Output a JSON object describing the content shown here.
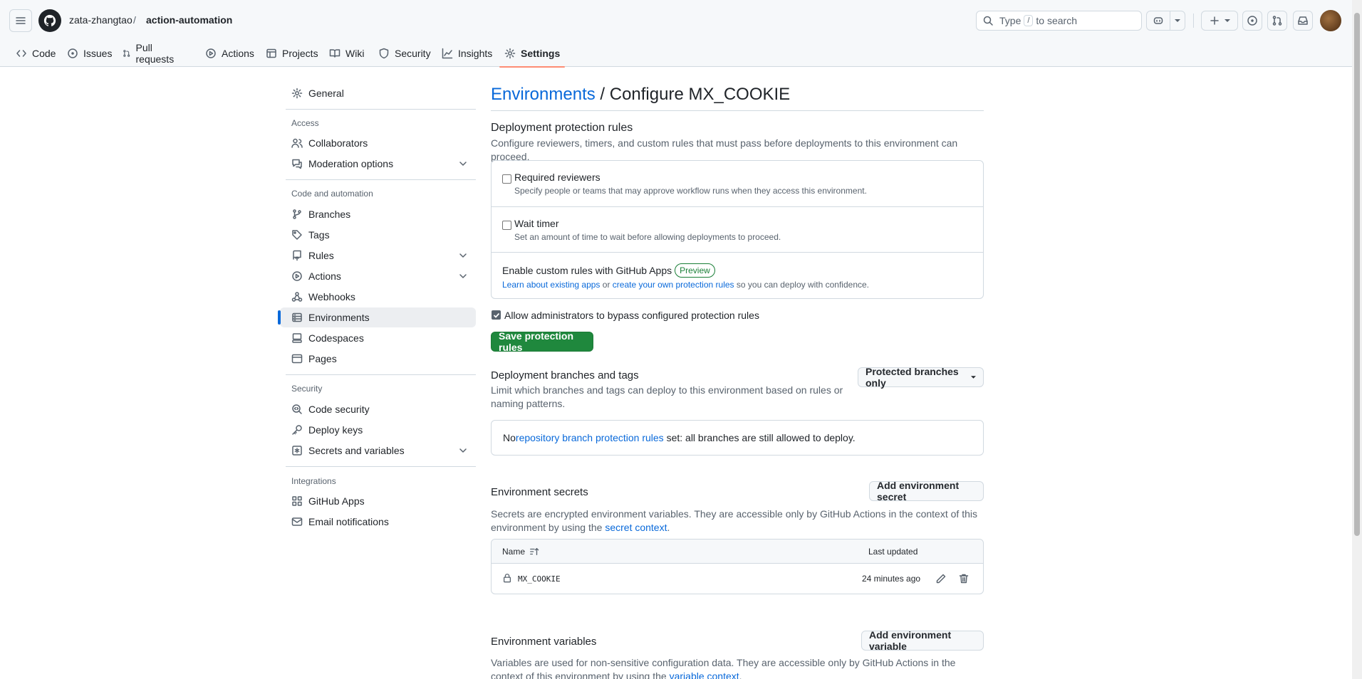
{
  "header": {
    "owner": "zata-zhangtao",
    "separator": "/",
    "repo": "action-automation",
    "search_placeholder_prefix": "Type",
    "search_key": "/",
    "search_placeholder_suffix": "to search"
  },
  "tabs": [
    {
      "label": "Code",
      "icon": "code-icon"
    },
    {
      "label": "Issues",
      "icon": "issue-opened-icon"
    },
    {
      "label": "Pull requests",
      "icon": "git-pull-request-icon"
    },
    {
      "label": "Actions",
      "icon": "play-icon"
    },
    {
      "label": "Projects",
      "icon": "table-icon"
    },
    {
      "label": "Wiki",
      "icon": "book-icon"
    },
    {
      "label": "Security",
      "icon": "shield-icon"
    },
    {
      "label": "Insights",
      "icon": "graph-icon"
    },
    {
      "label": "Settings",
      "icon": "gear-icon",
      "active": true
    }
  ],
  "sidebar": {
    "general": "General",
    "access_heading": "Access",
    "collaborators": "Collaborators",
    "moderation": "Moderation options",
    "code_heading": "Code and automation",
    "branches": "Branches",
    "tags": "Tags",
    "rules": "Rules",
    "actions": "Actions",
    "webhooks": "Webhooks",
    "environments": "Environments",
    "codespaces": "Codespaces",
    "pages": "Pages",
    "security_heading": "Security",
    "code_security": "Code security",
    "deploy_keys": "Deploy keys",
    "secrets": "Secrets and variables",
    "integrations_heading": "Integrations",
    "github_apps": "GitHub Apps",
    "email_notifications": "Email notifications"
  },
  "main": {
    "title_link": "Environments",
    "title_rest": " / Configure MX_COOKIE",
    "protection_heading": "Deployment protection rules",
    "protection_desc": "Configure reviewers, timers, and custom rules that must pass before deployments to this environment can proceed.",
    "required_reviewers": "Required reviewers",
    "required_reviewers_desc": "Specify people or teams that may approve workflow runs when they access this environment.",
    "wait_timer": "Wait timer",
    "wait_timer_desc": "Set an amount of time to wait before allowing deployments to proceed.",
    "custom_rules": "Enable custom rules with GitHub Apps",
    "preview_badge": "Preview",
    "learn_link": "Learn about existing apps",
    "or_text": " or ",
    "create_link": "create your own protection rules",
    "confidence_text": " so you can deploy with confidence.",
    "allow_admins": "Allow administrators to bypass configured protection rules",
    "allow_admins_checked": true,
    "save_button": "Save protection rules",
    "branches_heading": "Deployment branches and tags",
    "branches_desc": "Limit which branches and tags can deploy to this environment based on rules or naming patterns.",
    "branches_select": "Protected branches only",
    "no_text": "No ",
    "protection_link": "repository branch protection rules",
    "set_text": " set: all branches are still allowed to deploy.",
    "secrets_heading": "Environment secrets",
    "add_secret": "Add environment secret",
    "secrets_desc_1": "Secrets are encrypted environment variables. They are accessible only by GitHub Actions in the context of this environment by using the ",
    "secret_context_link": "secret context",
    "secrets_desc_end": ".",
    "col_name": "Name",
    "col_updated": "Last updated",
    "secret_row": {
      "name": "MX_COOKIE",
      "updated": "24 minutes ago"
    },
    "variables_heading": "Environment variables",
    "add_variable": "Add environment variable",
    "variables_desc_1": "Variables are used for non-sensitive configuration data. They are accessible only by GitHub Actions in the context of this environment by using the ",
    "variable_context_link": "variable context",
    "variables_desc_end": "."
  },
  "colors": {
    "accent": "#0969da",
    "primary_button": "#1f883d",
    "active_tab_underline": "#fd8c73"
  }
}
